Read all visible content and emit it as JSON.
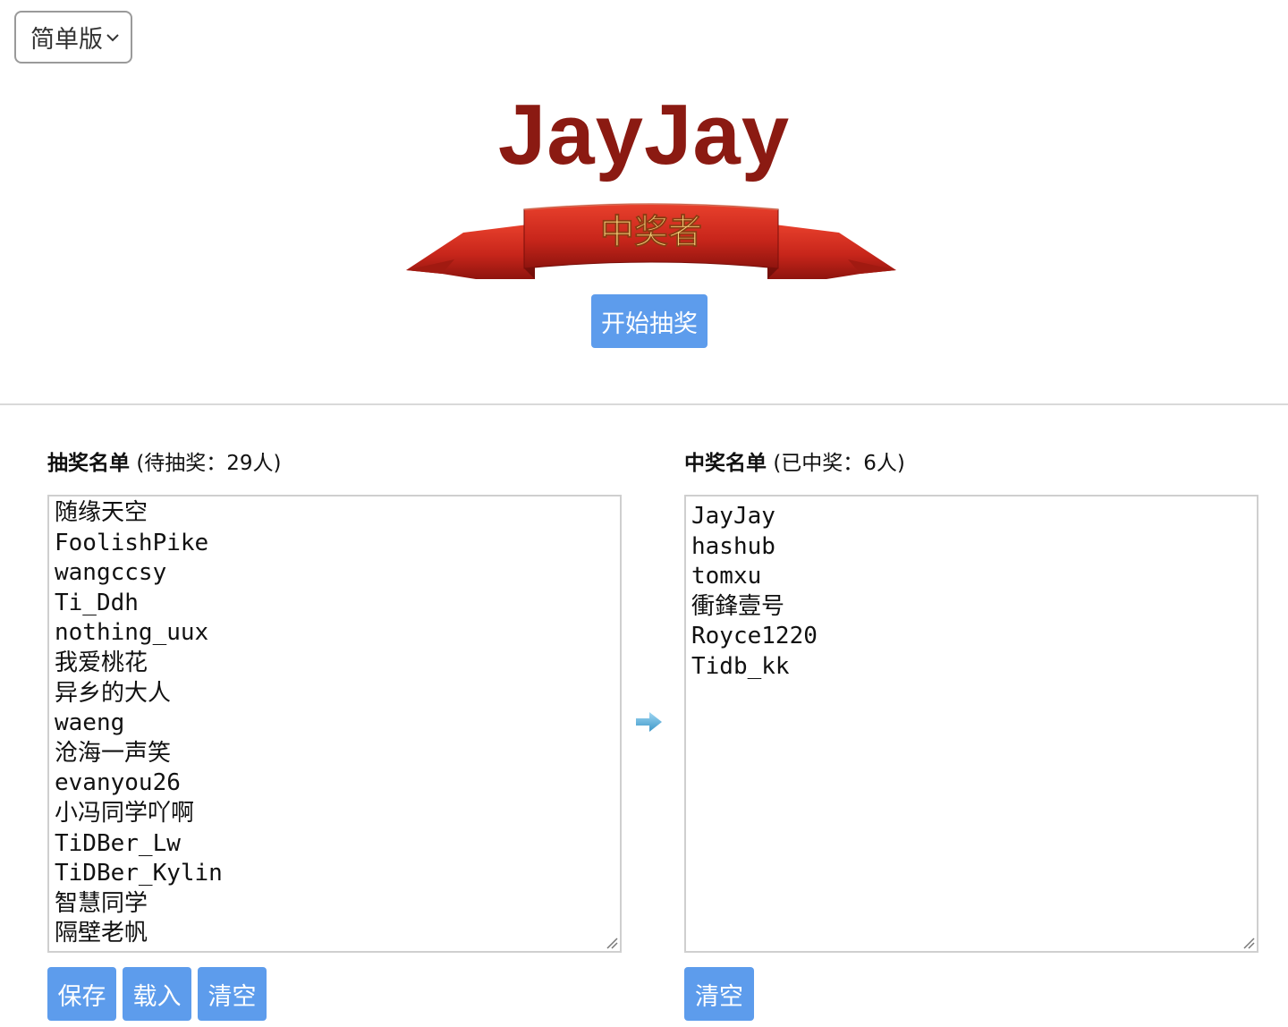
{
  "version_select": {
    "value": "简单版"
  },
  "winner_display": {
    "name": "JayJay"
  },
  "banner": {
    "text": "中奖者"
  },
  "start_button": {
    "label": "开始抽奖"
  },
  "draw_list": {
    "title_bold": "抽奖名单",
    "title_extra": "(待抽奖：29人)",
    "items": [
      "随缘天空",
      "FoolishPike",
      "wangccsy",
      "Ti_Ddh",
      "nothing_uux",
      "我爱桃花",
      "异乡的大人",
      "waeng",
      "沧海一声笑",
      "evanyou26",
      "小冯同学吖啊",
      "TiDBer_Lw",
      "TiDBer_Kylin",
      "智慧同学",
      "隔壁老帆"
    ],
    "buttons": {
      "save": "保存",
      "load": "载入",
      "clear": "清空"
    }
  },
  "winner_list": {
    "title_bold": "中奖名单",
    "title_extra": "(已中奖：6人)",
    "items": [
      "JayJay",
      "hashub",
      "tomxu",
      "衝鋒壹号",
      "Royce1220",
      "Tidb_kk"
    ],
    "buttons": {
      "clear": "清空"
    }
  },
  "icons": {
    "select_chevron": "chevron-down-icon",
    "transfer_arrow": "arrow-right-icon",
    "resize_grip": "resize-grip-icon"
  },
  "colors": {
    "accent_button": "#5d9cec",
    "winner_name": "#8b1a12",
    "banner_red": "#c8261b",
    "banner_text": "#f4d27a"
  }
}
